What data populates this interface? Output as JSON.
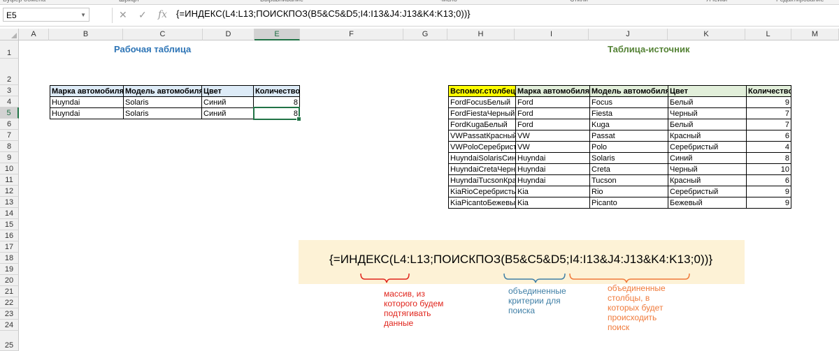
{
  "ribbon": [
    "Буфер обмена",
    "Шрифт",
    "Выравнивание",
    "Число",
    "Стили",
    "Ячейки",
    "Редактирование"
  ],
  "formula_bar": {
    "name_box": "E5",
    "formula": "{=ИНДЕКС(L4:L13;ПОИСКПОЗ(B5&C5&D5;I4:I13&J4:J13&K4:K13;0))}"
  },
  "columns": [
    "A",
    "B",
    "C",
    "D",
    "E",
    "F",
    "G",
    "H",
    "I",
    "J",
    "K",
    "L",
    "M"
  ],
  "rows": [
    "1",
    "2",
    "3",
    "4",
    "5",
    "6",
    "7",
    "8",
    "9",
    "10",
    "11",
    "12",
    "13",
    "14",
    "15",
    "16",
    "17",
    "18",
    "19",
    "20",
    "21",
    "22",
    "23",
    "24",
    "25"
  ],
  "work_title": "Рабочая таблица",
  "source_title": "Таблица-источник",
  "work_table": {
    "headers": [
      "Марка автомобиля",
      "Модель автомобиля",
      "Цвет",
      "Количество"
    ],
    "rows": [
      [
        "Huyndai",
        "Solaris",
        "Синий",
        "8"
      ],
      [
        "Huyndai",
        "Solaris",
        "Синий",
        "8"
      ]
    ]
  },
  "source_table": {
    "headers": [
      "Вспомог.столбец",
      "Марка автомобиля",
      "Модель автомобиля",
      "Цвет",
      "Количество"
    ],
    "rows": [
      [
        "FordFocusБелый",
        "Ford",
        "Focus",
        "Белый",
        "9"
      ],
      [
        "FordFiestaЧерный",
        "Ford",
        "Fiesta",
        "Черный",
        "7"
      ],
      [
        "FordKugaБелый",
        "Ford",
        "Kuga",
        "Белый",
        "7"
      ],
      [
        "VWPassatКрасный",
        "VW",
        "Passat",
        "Красный",
        "6"
      ],
      [
        "VWPoloСеребрист",
        "VW",
        "Polo",
        "Серебристый",
        "4"
      ],
      [
        "HuyndaiSolarisСини",
        "Huyndai",
        "Solaris",
        "Синий",
        "8"
      ],
      [
        "HuyndaiCretaЧерны",
        "Huyndai",
        "Creta",
        "Черный",
        "10"
      ],
      [
        "HuyndaiTucsonКрас",
        "Huyndai",
        "Tucson",
        "Красный",
        "6"
      ],
      [
        "KiaRioСеребристы",
        "Kia",
        "Rio",
        "Серебристый",
        "9"
      ],
      [
        "KiaPicantoБежевы",
        "Kia",
        "Picanto",
        "Бежевый",
        "9"
      ]
    ]
  },
  "callout": {
    "formula": "{=ИНДЕКС(L4:L13;ПОИСКПОЗ(B5&C5&D5;I4:I13&J4:J13&K4:K13;0))}",
    "note_red": "массив, из которого будем подтягивать данные",
    "note_blue": "объединенные критерии для поиска",
    "note_orange": "объединенные столбцы, в которых будет происходить поиск"
  },
  "colors": {
    "red": "#e0241b",
    "blue": "#3f7fa6",
    "orange": "#f07a3a",
    "title_blue": "#2e75b6",
    "title_green": "#548235",
    "header_blue": "#ddebf7",
    "header_green": "#e2efda",
    "header_yellow": "#ffff00",
    "excel_green": "#217346"
  }
}
